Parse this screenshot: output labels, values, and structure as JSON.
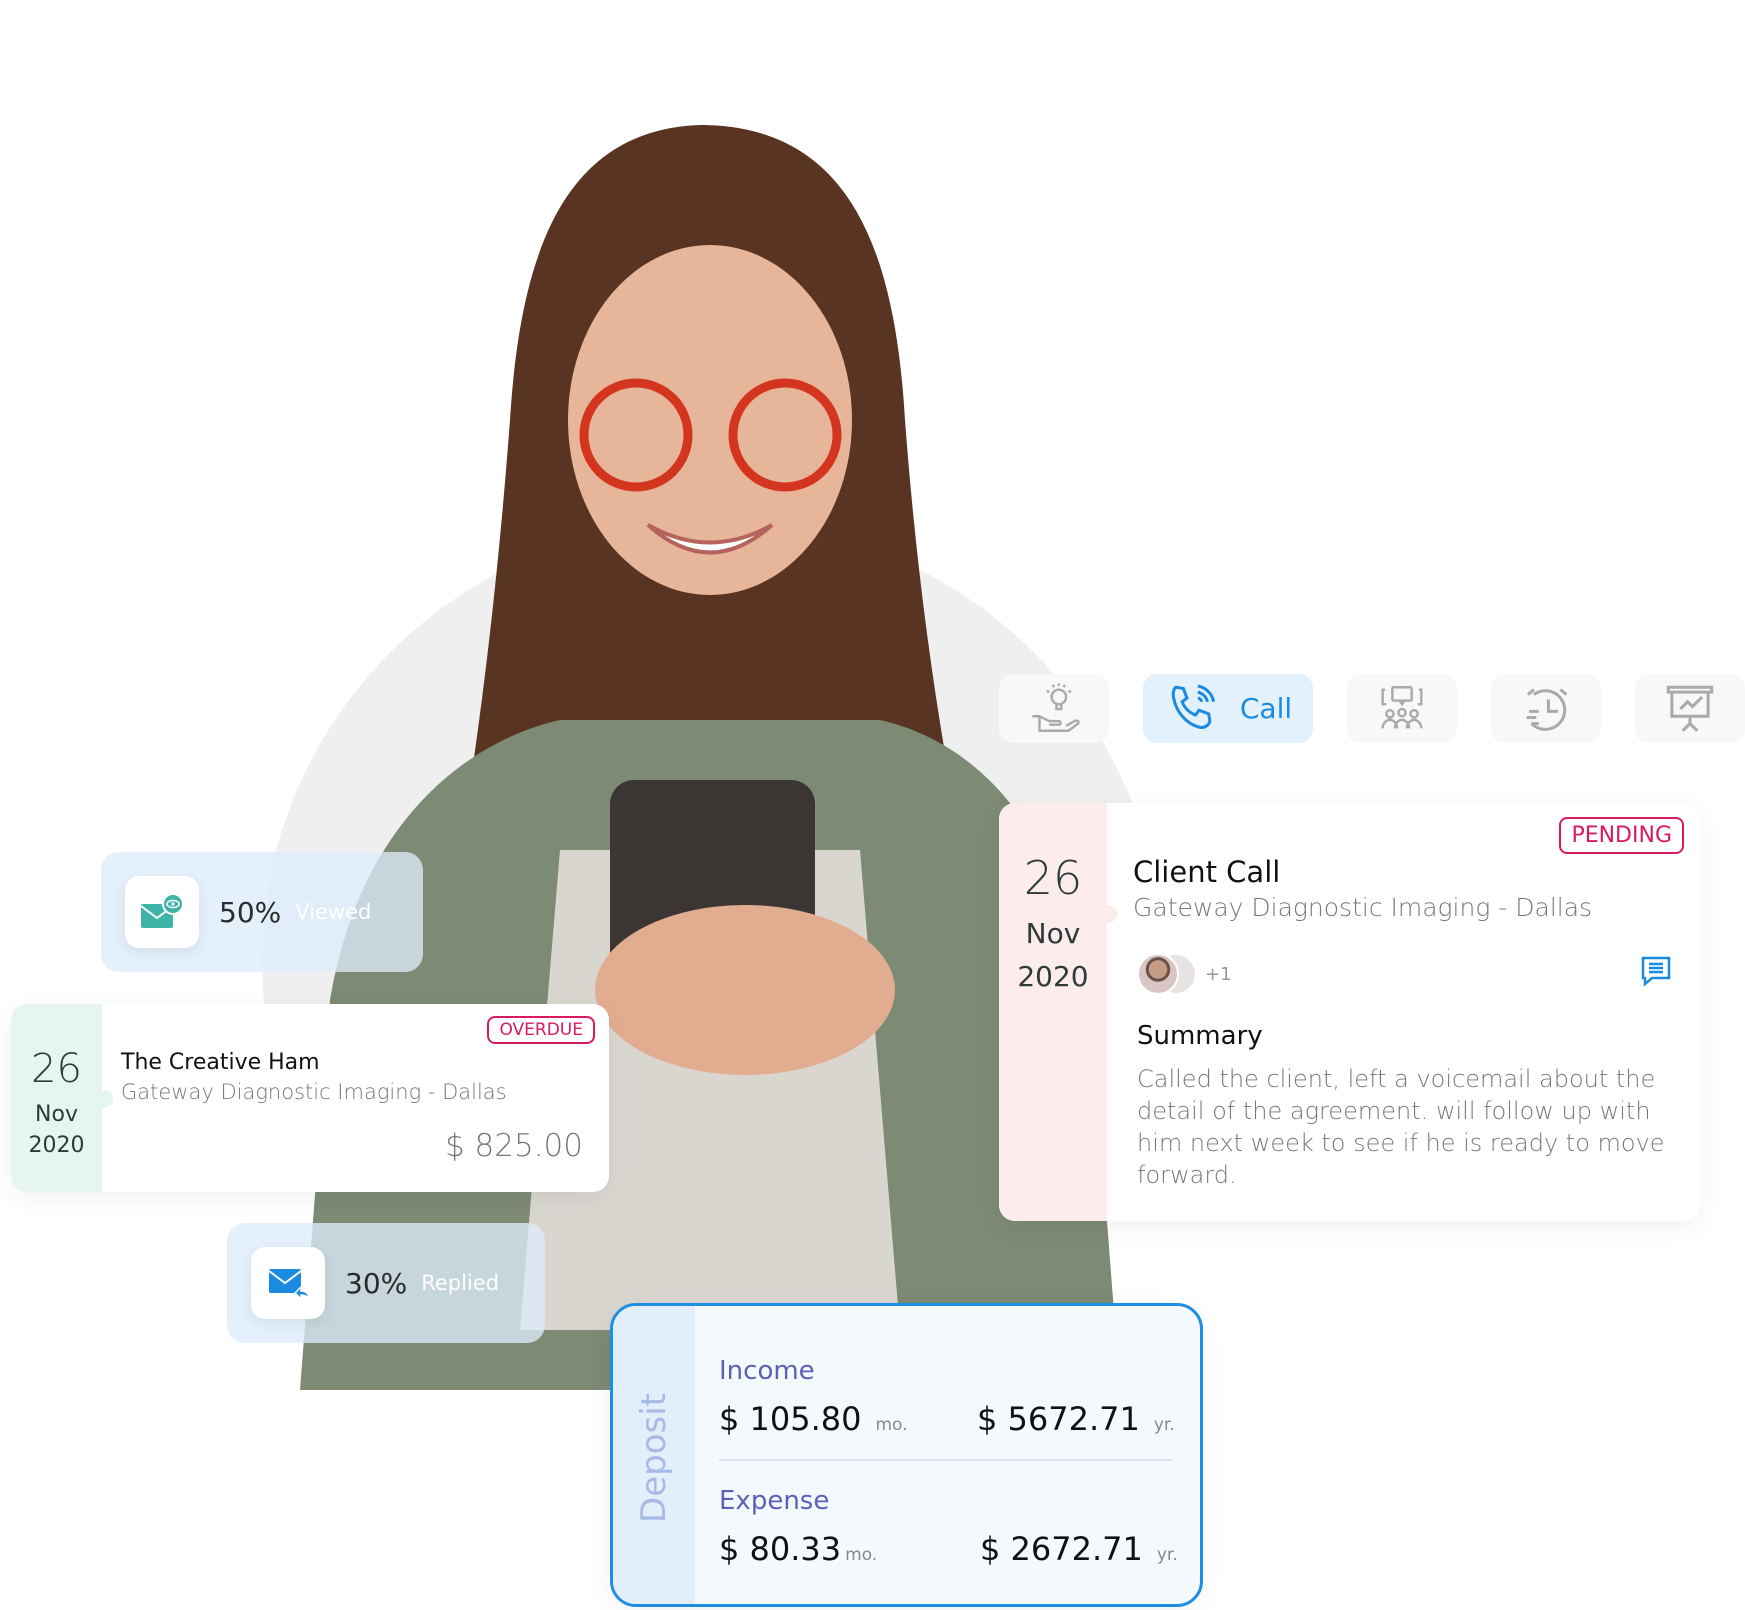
{
  "activity_types": [
    {
      "name": "idea",
      "icon": "idea-hand-icon",
      "label": ""
    },
    {
      "name": "call",
      "icon": "phone-call-icon",
      "label": "Call",
      "active": true
    },
    {
      "name": "meeting",
      "icon": "meeting-icon",
      "label": ""
    },
    {
      "name": "deadline",
      "icon": "timer-icon",
      "label": ""
    },
    {
      "name": "presentation",
      "icon": "presentation-icon",
      "label": ""
    }
  ],
  "client_call": {
    "day": "26",
    "month": "Nov",
    "year": "2020",
    "status": "PENDING",
    "title": "Client Call",
    "subtitle": "Gateway Diagnostic Imaging - Dallas",
    "extra_participants": "+1",
    "summary_heading": "Summary",
    "summary_text": "Called the client, left a voicemail about the detail of the agreement. will follow up with him next week to see if he is ready to move forward."
  },
  "viewed_stat": {
    "percent": "50%",
    "label": "Viewed"
  },
  "replied_stat": {
    "percent": "30%",
    "label": "Replied"
  },
  "invoice": {
    "day": "26",
    "month": "Nov",
    "year": "2020",
    "status": "OVERDUE",
    "title": "The Creative Ham",
    "subtitle": "Gateway Diagnostic Imaging - Dallas",
    "amount": "$ 825.00"
  },
  "deposit": {
    "label": "Deposit",
    "income": {
      "heading": "Income",
      "monthly": "$ 105.80",
      "monthly_unit": "mo.",
      "yearly": "$ 5672.71",
      "yearly_unit": "yr."
    },
    "expense": {
      "heading": "Expense",
      "monthly": "$ 80.33",
      "monthly_unit": "mo.",
      "yearly": "$ 2672.71",
      "yearly_unit": "yr."
    }
  },
  "colors": {
    "accent": "#1d8fe1",
    "status": "#d81b60",
    "heading": "#5b62b6"
  }
}
